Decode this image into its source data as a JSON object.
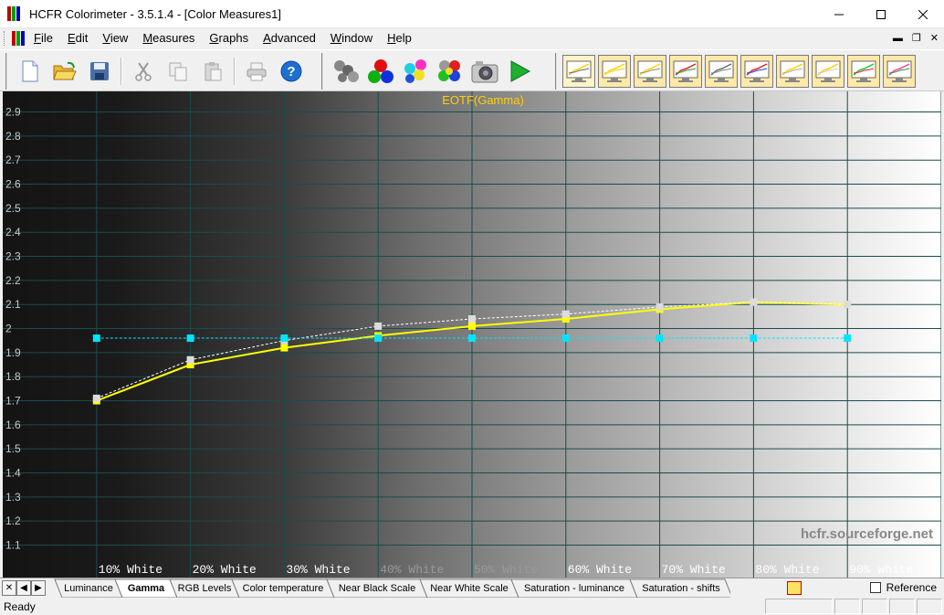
{
  "window": {
    "title": "HCFR Colorimeter - 3.5.1.4 - [Color Measures1]",
    "controls": [
      "minimize-icon",
      "maximize-icon",
      "close-icon"
    ]
  },
  "menu": {
    "items": [
      "File",
      "Edit",
      "View",
      "Measures",
      "Graphs",
      "Advanced",
      "Window",
      "Help"
    ]
  },
  "toolbar": {
    "buttons": [
      "new-icon",
      "open-icon",
      "save-icon",
      "cut-icon",
      "copy-icon",
      "paste-icon",
      "print-icon",
      "help-icon",
      "sensor-icon",
      "rgb-icon",
      "colors-icon",
      "multicolor-icon",
      "camera-icon",
      "play-icon"
    ],
    "graph_buttons": [
      "graph-1",
      "graph-2",
      "graph-3",
      "graph-4",
      "graph-5",
      "cie-graph",
      "graph-7",
      "graph-8",
      "graph-9",
      "graph-10"
    ]
  },
  "chart_data": {
    "type": "line",
    "title": "EOTF(Gamma)",
    "categories": [
      "10% White",
      "20% White",
      "30% White",
      "40% White",
      "50% White",
      "60% White",
      "70% White",
      "80% White",
      "90% White"
    ],
    "yticks": [
      "2.9",
      "2.8",
      "2.7",
      "2.6",
      "2.5",
      "2.4",
      "2.3",
      "2.2",
      "2.1",
      "2",
      "1.9",
      "1.8",
      "1.7",
      "1.6",
      "1.5",
      "1.4",
      "1.3",
      "1.2",
      "1.1"
    ],
    "ylim": [
      1.0,
      2.95
    ],
    "grid": true,
    "watermark": "hcfr.sourceforge.net",
    "series": [
      {
        "values": [
          1.7,
          1.85,
          1.92,
          1.97,
          2.01,
          2.04,
          2.08,
          2.11,
          2.1
        ],
        "color": "#ffff00",
        "style": "solid"
      },
      {
        "values": [
          1.71,
          1.87,
          1.95,
          2.01,
          2.04,
          2.06,
          2.09,
          2.11,
          2.1
        ],
        "color": "#ffffff",
        "style": "dashed"
      },
      {
        "values": [
          1.96,
          1.96,
          1.96,
          1.96,
          1.96,
          1.96,
          1.96,
          1.96,
          1.96
        ],
        "color": "#00e5ff",
        "style": "dashed"
      }
    ]
  },
  "tabs": {
    "items": [
      "Luminance",
      "Gamma",
      "RGB Levels",
      "Color temperature",
      "Near Black Scale",
      "Near White Scale",
      "Saturation - luminance",
      "Saturation - shifts"
    ],
    "active": "Gamma",
    "reference_label": "Reference"
  },
  "status": {
    "text": "Ready"
  }
}
